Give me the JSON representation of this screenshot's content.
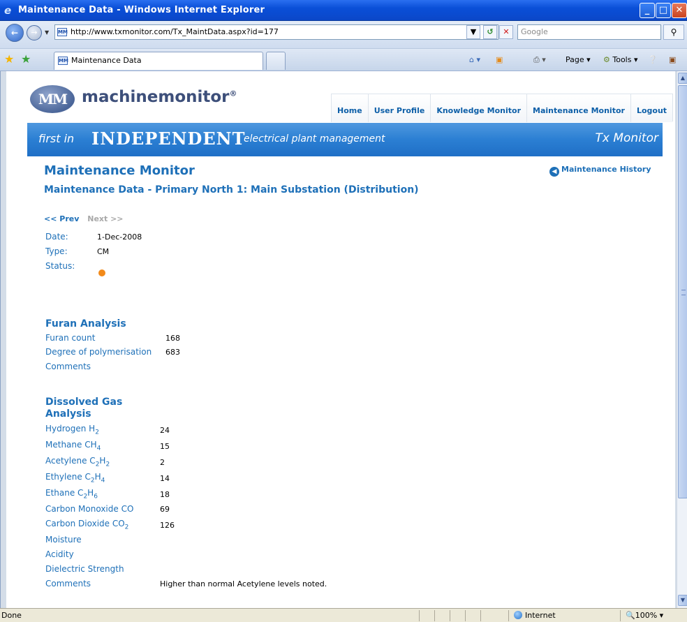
{
  "window": {
    "title": "Maintenance Data - Windows Internet Explorer",
    "min_label": "_",
    "max_label": "□",
    "close_label": "✕"
  },
  "address": {
    "url": "http://www.txmonitor.com/Tx_MaintData.aspx?id=177",
    "search_placeholder": "Google"
  },
  "tabs": [
    {
      "label": "Maintenance Data"
    }
  ],
  "commands": {
    "page": "Page",
    "tools": "Tools"
  },
  "site": {
    "logo_badge": "MM",
    "logo_text": "machinemonitor",
    "logo_reg": "®",
    "nav": [
      "Home",
      "User Profile",
      "Knowledge Monitor",
      "Maintenance Monitor",
      "Logout"
    ],
    "banner": {
      "first_in": "first in",
      "independent": "INDEPENDENT",
      "tagline": "electrical plant management",
      "product": "Tx Monitor"
    }
  },
  "main": {
    "heading": "Maintenance Monitor",
    "history_link": "Maintenance History",
    "subheading": "Maintenance Data - Primary North 1: Main Substation (Distribution)",
    "prev": "<< Prev",
    "next": "Next >>",
    "date_label": "Date:",
    "date_value": "1-Dec-2008",
    "type_label": "Type:",
    "type_value": "CM",
    "status_label": "Status:",
    "status_color": "#f28a1a"
  },
  "furan": {
    "heading": "Furan Analysis",
    "furan_count_label": "Furan count",
    "furan_count_value": "168",
    "dp_label": "Degree of polymerisation",
    "dp_value": "683",
    "comments_label": "Comments"
  },
  "dga": {
    "heading_line1": "Dissolved Gas",
    "heading_line2": "Analysis",
    "rows": [
      {
        "name": "Hydrogen H",
        "sub": "2",
        "value": "24"
      },
      {
        "name": "Methane CH",
        "sub": "4",
        "value": "15"
      },
      {
        "name": "Acetylene C",
        "sub": "2",
        "mid": "H",
        "sub2": "2",
        "value": "2"
      },
      {
        "name": "Ethylene C",
        "sub": "2",
        "mid": "H",
        "sub2": "4",
        "value": "14"
      },
      {
        "name": "Ethane C",
        "sub": "2",
        "mid": "H",
        "sub2": "6",
        "value": "18"
      },
      {
        "name": "Carbon Monoxide CO",
        "value": "69"
      },
      {
        "name": "Carbon Dioxide CO",
        "sub": "2",
        "value": "126"
      },
      {
        "name": "Moisture"
      },
      {
        "name": "Acidity"
      },
      {
        "name": "Dielectric Strength"
      },
      {
        "name": "Comments",
        "value": "Higher than normal Acetylene levels noted."
      }
    ]
  },
  "statusbar": {
    "text": "Done",
    "zone": "Internet",
    "zoom": "100%"
  }
}
